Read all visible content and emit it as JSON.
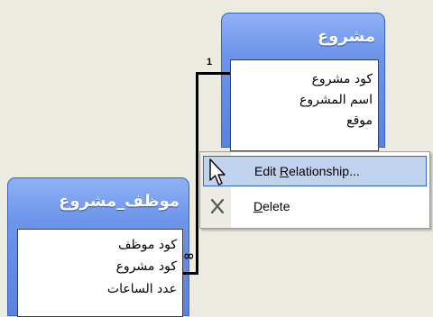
{
  "table_project": {
    "title": "مشروع",
    "fields": [
      "كود مشروع",
      "اسم المشروع",
      "موقع"
    ]
  },
  "table_employee_project": {
    "title": "موظف_مشروع",
    "fields": [
      "كود موظف",
      "كود مشروع",
      "عدد الساعات"
    ]
  },
  "relationship": {
    "one_side": "1",
    "many_side": "∞"
  },
  "context_menu": {
    "items": [
      {
        "pre": "Edit ",
        "accel": "R",
        "post": "elationship...",
        "selected": true
      },
      {
        "pre": "",
        "accel": "D",
        "post": "elete",
        "selected": false
      }
    ]
  }
}
